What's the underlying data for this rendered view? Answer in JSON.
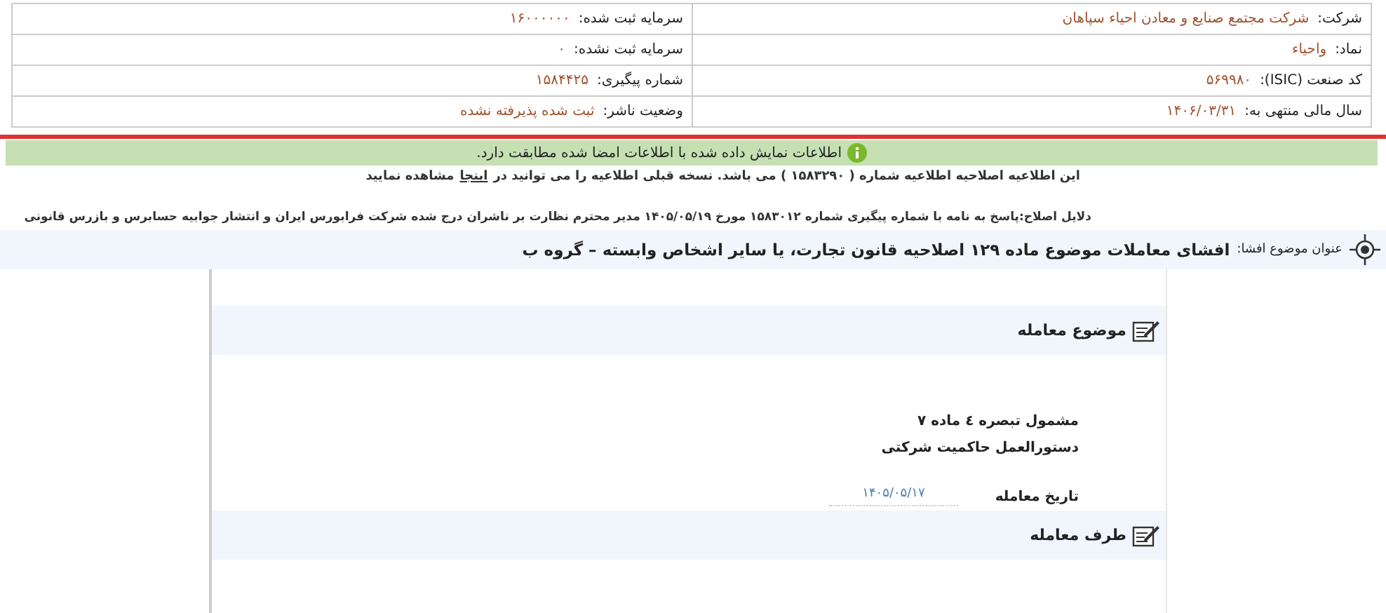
{
  "info_table": {
    "rows": [
      {
        "right": {
          "label": "شرکت:",
          "value": "شرکت مجتمع صنایع و معادن احیاء سپاهان"
        },
        "left": {
          "label": "سرمایه ثبت شده:",
          "value": "۱۶۰۰۰۰۰۰"
        }
      },
      {
        "right": {
          "label": "نماد:",
          "value": "واحیاء"
        },
        "left": {
          "label": "سرمایه ثبت نشده:",
          "value": "۰"
        }
      },
      {
        "right": {
          "label": "کد صنعت (ISIC):",
          "value": "۵۶۹۹۸۰"
        },
        "left": {
          "label": "شماره پیگیری:",
          "value": "۱۵۸۴۴۲۵"
        }
      },
      {
        "right": {
          "label": "سال مالی منتهی به:",
          "value": "۱۴۰۶/۰۳/۳۱"
        },
        "left": {
          "label": "وضعیت ناشر:",
          "value": "ثبت شده پذیرفته نشده"
        }
      }
    ]
  },
  "verification_banner": "اطلاعات نمایش داده شده با اطلاعات امضا شده مطابقت دارد.",
  "correction_notice": {
    "before": "این اطلاعیه اصلاحیه اطلاعیه شماره ( ۱۵۸۳۲۹۰ ) می باشد. نسخه قبلی اطلاعیه را می توانید در",
    "link": "اینجا",
    "after": "مشاهده نمایید"
  },
  "correction_reasons": "دلایل اصلاح:پاسخ به نامه با شماره پیگیری شماره ۱۵۸۳۰۱۲ مورخ ۱۴۰۵/۰۵/۱۹ مدیر محترم نظارت بر ناشران درج شده شرکت فرابورس ایران و انتشار جوابیه حسابرس و بازرس قانونی",
  "disclosure_subject": {
    "label": "عنوان موضوع افشا:",
    "value": "افشای معاملات موضوع ماده ۱۲۹ اصلاحیه قانون تجارت، یا سایر اشخاص وابسته – گروه ب"
  },
  "sections": [
    {
      "title": "موضوع معامله",
      "description": "مشمول تبصره ٤ ماده ۷ دستورالعمل حاکمیت شرکتی",
      "fields": [
        {
          "label": "تاریخ معامله",
          "value": "۱۴۰۵/۰۵/۱۷"
        }
      ]
    },
    {
      "title": "طرف معامله"
    }
  ]
}
